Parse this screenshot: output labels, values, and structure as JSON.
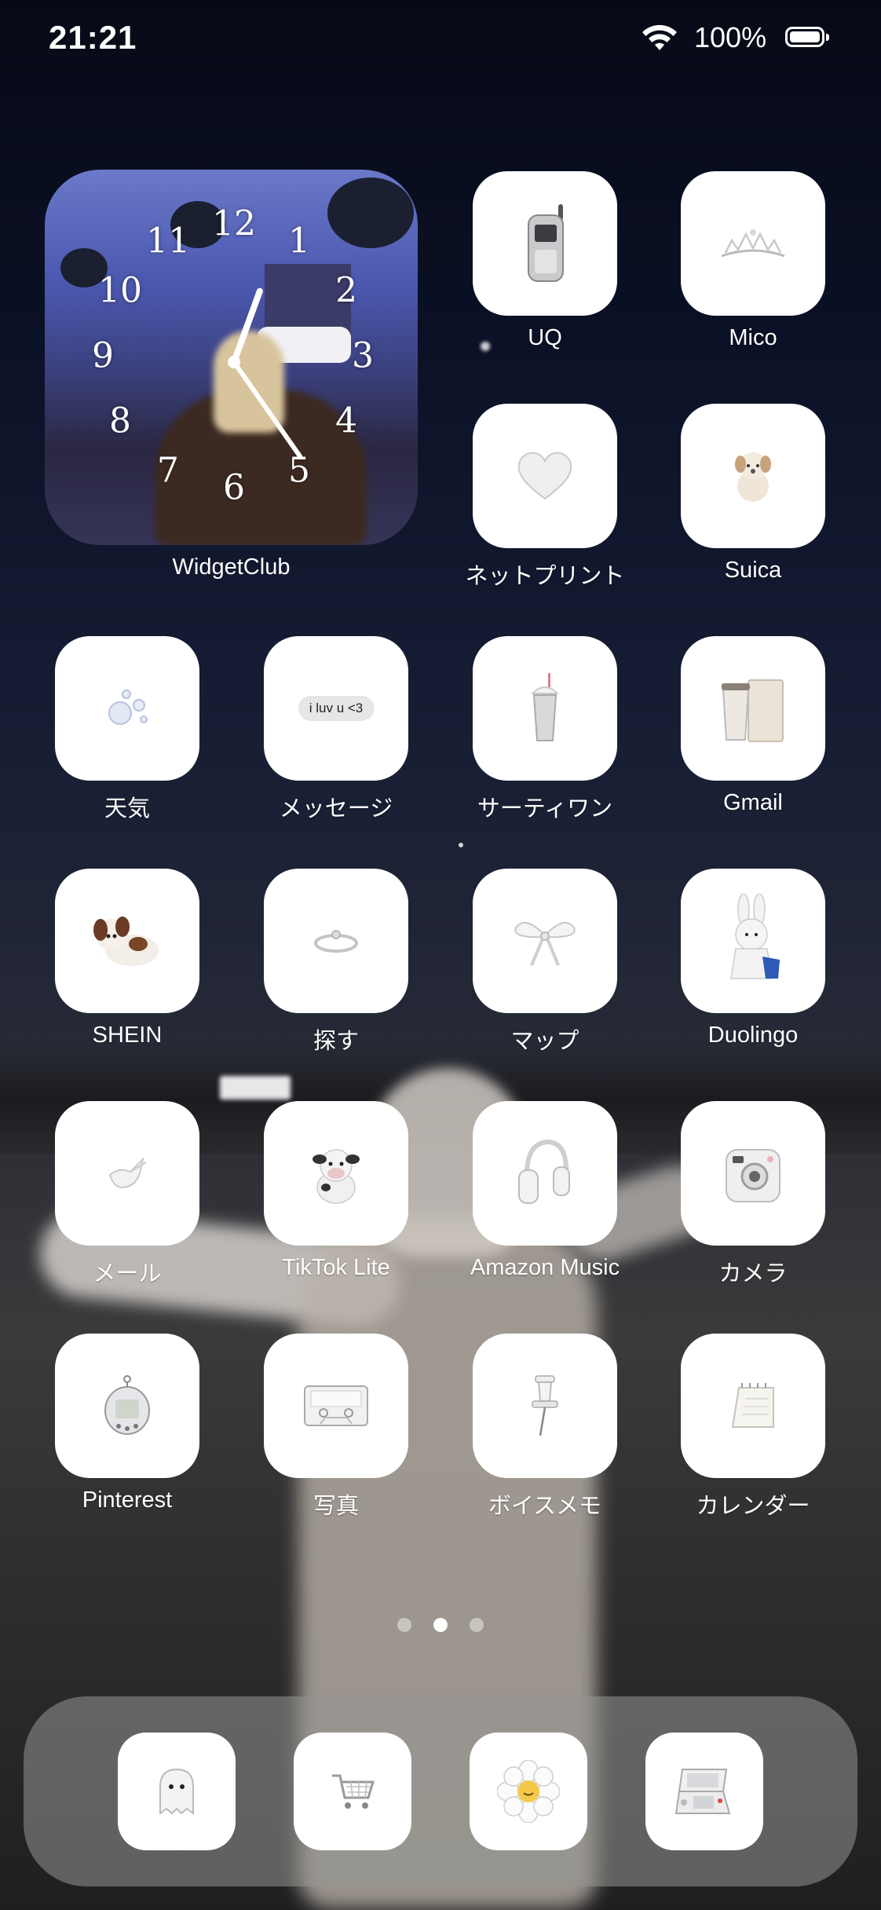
{
  "status_bar": {
    "time": "21:21",
    "battery_percent": "100%"
  },
  "widget": {
    "name": "WidgetClub",
    "clock_numerals": [
      "12",
      "1",
      "2",
      "3",
      "4",
      "5",
      "6",
      "7",
      "8",
      "9",
      "10",
      "11"
    ],
    "clock_time": "1:25"
  },
  "apps": [
    {
      "label": "UQ",
      "icon": "flip-phone-icon"
    },
    {
      "label": "Mico",
      "icon": "tiara-icon"
    },
    {
      "label": "ネットプリント",
      "icon": "heart-icon"
    },
    {
      "label": "Suica",
      "icon": "teddy-dog-icon"
    },
    {
      "label": "天気",
      "icon": "bubbles-icon"
    },
    {
      "label": "メッセージ",
      "icon": "chat-bubble-icon",
      "bubble_text": "i luv u <3"
    },
    {
      "label": "サーティワン",
      "icon": "milkshake-icon"
    },
    {
      "label": "Gmail",
      "icon": "coffee-bag-icon"
    },
    {
      "label": "SHEIN",
      "icon": "plush-puppy-icon"
    },
    {
      "label": "探す",
      "icon": "ring-icon"
    },
    {
      "label": "マップ",
      "icon": "ribbon-bow-icon"
    },
    {
      "label": "Duolingo",
      "icon": "bunny-plush-icon"
    },
    {
      "label": "メール",
      "icon": "bird-icon"
    },
    {
      "label": "TikTok Lite",
      "icon": "cow-plush-icon"
    },
    {
      "label": "Amazon Music",
      "icon": "headphones-icon"
    },
    {
      "label": "カメラ",
      "icon": "instant-camera-icon"
    },
    {
      "label": "Pinterest",
      "icon": "tamagotchi-icon"
    },
    {
      "label": "写真",
      "icon": "cassette-icon"
    },
    {
      "label": "ボイスメモ",
      "icon": "pushpin-icon"
    },
    {
      "label": "カレンダー",
      "icon": "desk-calendar-icon"
    }
  ],
  "page_dots": {
    "count": 3,
    "active_index": 1
  },
  "dock": [
    {
      "icon": "ghost-icon"
    },
    {
      "icon": "shopping-cart-icon"
    },
    {
      "icon": "daisy-flower-icon"
    },
    {
      "icon": "game-console-icon"
    }
  ]
}
